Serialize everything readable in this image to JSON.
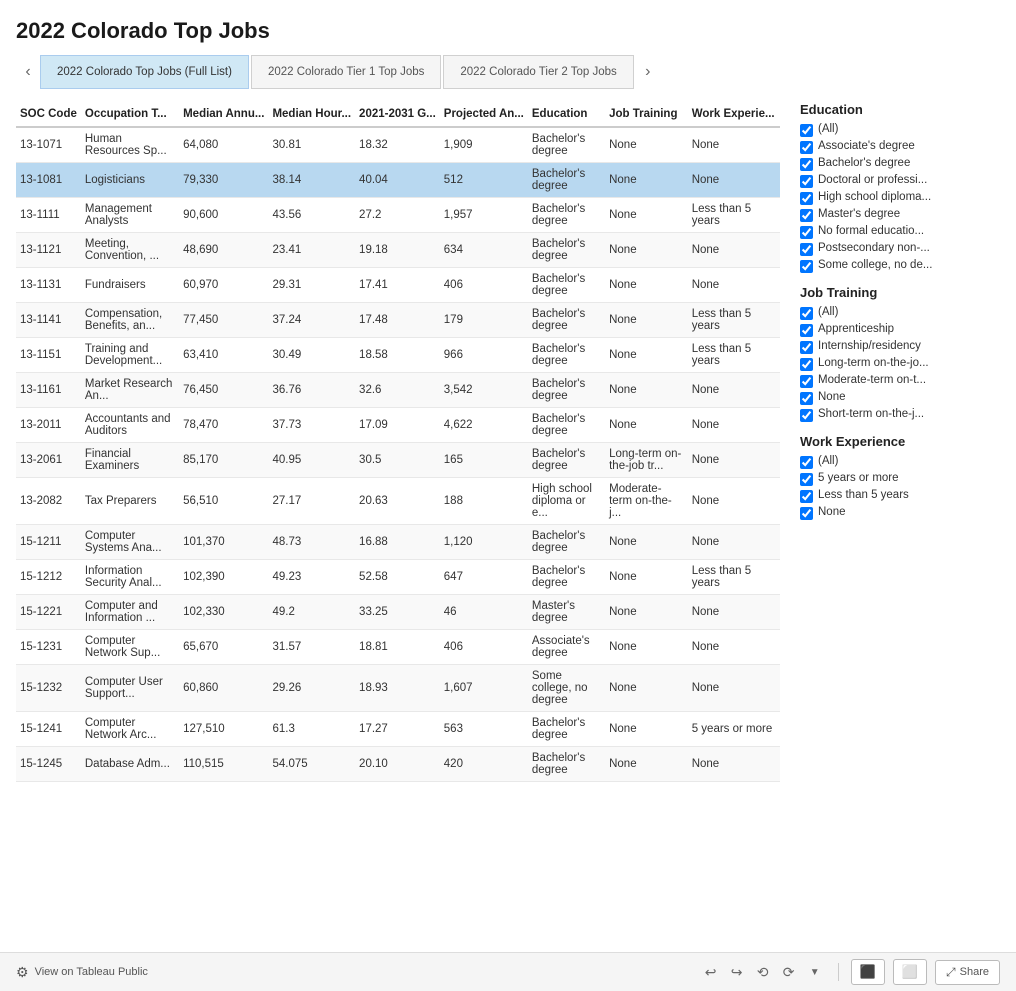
{
  "title": "2022 Colorado Top Jobs",
  "tabs": [
    {
      "label": "2022 Colorado Top Jobs (Full List)",
      "active": true
    },
    {
      "label": "2022 Colorado Tier 1 Top Jobs",
      "active": false
    },
    {
      "label": "2022 Colorado Tier 2 Top Jobs",
      "active": false
    }
  ],
  "columns": [
    {
      "key": "soc",
      "label": "SOC Code"
    },
    {
      "key": "occ",
      "label": "Occupation T..."
    },
    {
      "key": "ann",
      "label": "Median Annu..."
    },
    {
      "key": "hour",
      "label": "Median Hour..."
    },
    {
      "key": "growth",
      "label": "2021-2031 G..."
    },
    {
      "key": "proj",
      "label": "Projected An..."
    },
    {
      "key": "edu",
      "label": "Education"
    },
    {
      "key": "train",
      "label": "Job Training"
    },
    {
      "key": "work",
      "label": "Work Experie..."
    }
  ],
  "rows": [
    {
      "soc": "13-1071",
      "occ": "Human Resources Sp...",
      "ann": "64,080",
      "hour": "30.81",
      "growth": "18.32",
      "proj": "1,909",
      "edu": "Bachelor's degree",
      "train": "None",
      "work": "None",
      "highlight": false
    },
    {
      "soc": "13-1081",
      "occ": "Logisticians",
      "ann": "79,330",
      "hour": "38.14",
      "growth": "40.04",
      "proj": "512",
      "edu": "Bachelor's degree",
      "train": "None",
      "work": "None",
      "highlight": true
    },
    {
      "soc": "13-1111",
      "occ": "Management Analysts",
      "ann": "90,600",
      "hour": "43.56",
      "growth": "27.2",
      "proj": "1,957",
      "edu": "Bachelor's degree",
      "train": "None",
      "work": "Less than 5 years",
      "highlight": false
    },
    {
      "soc": "13-1121",
      "occ": "Meeting, Convention, ...",
      "ann": "48,690",
      "hour": "23.41",
      "growth": "19.18",
      "proj": "634",
      "edu": "Bachelor's degree",
      "train": "None",
      "work": "None",
      "highlight": false
    },
    {
      "soc": "13-1131",
      "occ": "Fundraisers",
      "ann": "60,970",
      "hour": "29.31",
      "growth": "17.41",
      "proj": "406",
      "edu": "Bachelor's degree",
      "train": "None",
      "work": "None",
      "highlight": false
    },
    {
      "soc": "13-1141",
      "occ": "Compensation, Benefits, an...",
      "ann": "77,450",
      "hour": "37.24",
      "growth": "17.48",
      "proj": "179",
      "edu": "Bachelor's degree",
      "train": "None",
      "work": "Less than 5 years",
      "highlight": false
    },
    {
      "soc": "13-1151",
      "occ": "Training and Development...",
      "ann": "63,410",
      "hour": "30.49",
      "growth": "18.58",
      "proj": "966",
      "edu": "Bachelor's degree",
      "train": "None",
      "work": "Less than 5 years",
      "highlight": false
    },
    {
      "soc": "13-1161",
      "occ": "Market Research An...",
      "ann": "76,450",
      "hour": "36.76",
      "growth": "32.6",
      "proj": "3,542",
      "edu": "Bachelor's degree",
      "train": "None",
      "work": "None",
      "highlight": false
    },
    {
      "soc": "13-2011",
      "occ": "Accountants and Auditors",
      "ann": "78,470",
      "hour": "37.73",
      "growth": "17.09",
      "proj": "4,622",
      "edu": "Bachelor's degree",
      "train": "None",
      "work": "None",
      "highlight": false
    },
    {
      "soc": "13-2061",
      "occ": "Financial Examiners",
      "ann": "85,170",
      "hour": "40.95",
      "growth": "30.5",
      "proj": "165",
      "edu": "Bachelor's degree",
      "train": "Long-term on-the-job tr...",
      "work": "None",
      "highlight": false
    },
    {
      "soc": "13-2082",
      "occ": "Tax Preparers",
      "ann": "56,510",
      "hour": "27.17",
      "growth": "20.63",
      "proj": "188",
      "edu": "High school diploma or e...",
      "train": "Moderate-term on-the-j...",
      "work": "None",
      "highlight": false
    },
    {
      "soc": "15-1211",
      "occ": "Computer Systems Ana...",
      "ann": "101,370",
      "hour": "48.73",
      "growth": "16.88",
      "proj": "1,120",
      "edu": "Bachelor's degree",
      "train": "None",
      "work": "None",
      "highlight": false
    },
    {
      "soc": "15-1212",
      "occ": "Information Security Anal...",
      "ann": "102,390",
      "hour": "49.23",
      "growth": "52.58",
      "proj": "647",
      "edu": "Bachelor's degree",
      "train": "None",
      "work": "Less than 5 years",
      "highlight": false
    },
    {
      "soc": "15-1221",
      "occ": "Computer and Information ...",
      "ann": "102,330",
      "hour": "49.2",
      "growth": "33.25",
      "proj": "46",
      "edu": "Master's degree",
      "train": "None",
      "work": "None",
      "highlight": false
    },
    {
      "soc": "15-1231",
      "occ": "Computer Network Sup...",
      "ann": "65,670",
      "hour": "31.57",
      "growth": "18.81",
      "proj": "406",
      "edu": "Associate's degree",
      "train": "None",
      "work": "None",
      "highlight": false
    },
    {
      "soc": "15-1232",
      "occ": "Computer User Support...",
      "ann": "60,860",
      "hour": "29.26",
      "growth": "18.93",
      "proj": "1,607",
      "edu": "Some college, no degree",
      "train": "None",
      "work": "None",
      "highlight": false
    },
    {
      "soc": "15-1241",
      "occ": "Computer Network Arc...",
      "ann": "127,510",
      "hour": "61.3",
      "growth": "17.27",
      "proj": "563",
      "edu": "Bachelor's degree",
      "train": "None",
      "work": "5 years or more",
      "highlight": false
    },
    {
      "soc": "15-1245",
      "occ": "Database Adm...",
      "ann": "110,515",
      "hour": "54.075",
      "growth": "20.10",
      "proj": "420",
      "edu": "Bachelor's degree",
      "train": "None",
      "work": "None",
      "highlight": false
    }
  ],
  "filters": {
    "education": {
      "title": "Education",
      "items": [
        {
          "label": "(All)",
          "checked": true
        },
        {
          "label": "Associate's degree",
          "checked": true
        },
        {
          "label": "Bachelor's degree",
          "checked": true
        },
        {
          "label": "Doctoral or professi...",
          "checked": true
        },
        {
          "label": "High school diploma...",
          "checked": true
        },
        {
          "label": "Master's degree",
          "checked": true
        },
        {
          "label": "No formal educatio...",
          "checked": true
        },
        {
          "label": "Postsecondary non-...",
          "checked": true
        },
        {
          "label": "Some college, no de...",
          "checked": true
        }
      ]
    },
    "jobTraining": {
      "title": "Job Training",
      "items": [
        {
          "label": "(All)",
          "checked": true
        },
        {
          "label": "Apprenticeship",
          "checked": true
        },
        {
          "label": "Internship/residency",
          "checked": true
        },
        {
          "label": "Long-term on-the-jo...",
          "checked": true
        },
        {
          "label": "Moderate-term on-t...",
          "checked": true
        },
        {
          "label": "None",
          "checked": true
        },
        {
          "label": "Short-term on-the-j...",
          "checked": true
        }
      ]
    },
    "workExperience": {
      "title": "Work Experience",
      "items": [
        {
          "label": "(All)",
          "checked": true
        },
        {
          "label": "5 years or more",
          "checked": true
        },
        {
          "label": "Less than 5 years",
          "checked": true
        },
        {
          "label": "None",
          "checked": true
        }
      ]
    }
  },
  "bottomBar": {
    "tableauLabel": "View on Tableau Public",
    "shareLabel": "Share"
  }
}
